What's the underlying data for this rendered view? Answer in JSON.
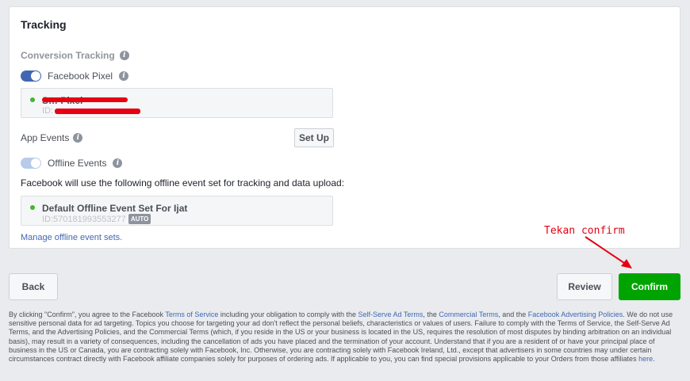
{
  "card": {
    "title": "Tracking",
    "conversion_label": "Conversion Tracking",
    "pixel_toggle_label": "Facebook Pixel",
    "pixel": {
      "name": "S… Pixel",
      "id_prefix": "ID:"
    },
    "app_events_label": "App Events",
    "setup_label": "Set Up",
    "offline_toggle_label": "Offline Events",
    "offline_description": "Facebook will use the following offline event set for tracking and data upload:",
    "offline_set": {
      "name": "Default Offline Event Set For Ijat",
      "id": "ID:570181993553277",
      "badge": "AUTO"
    },
    "manage_link": "Manage offline event sets."
  },
  "actions": {
    "back": "Back",
    "review": "Review",
    "confirm": "Confirm"
  },
  "annotation": {
    "text": "Tekan confirm",
    "color": "#e60012"
  },
  "legal": {
    "p1": "By clicking \"Confirm\", you agree to the Facebook ",
    "l1": "Terms of Service",
    "p2": " including your obligation to comply with the ",
    "l2": "Self-Serve Ad Terms",
    "p3": ", the ",
    "l3": "Commercial Terms",
    "p4": ", and the ",
    "l4": "Facebook Advertising Policies",
    "p5": ". We do not use sensitive personal data for ad targeting. Topics you choose for targeting your ad don't reflect the personal beliefs, characteristics or values of users. Failure to comply with the Terms of Service, the Self-Serve Ad Terms, and the Advertising Policies, and the Commercial Terms (which, if you reside in the US or your business is located in the US, requires the resolution of most disputes by binding arbitration on an individual basis), may result in a variety of consequences, including the cancellation of ads you have placed and the termination of your account. Understand that if you are a resident of or have your principal place of business in the US or Canada, you are contracting solely with Facebook, Inc. Otherwise, you are contracting solely with Facebook Ireland, Ltd., except that advertisers in some countries may under certain circumstances contract directly with Facebook affiliate companies solely for purposes of ordering ads. If applicable to you, you can find special provisions applicable to your Orders from those affiliates ",
    "l5": "here",
    "p6": "."
  },
  "colors": {
    "accent": "#4267b2",
    "confirm": "#00a400",
    "status_active": "#42b72a"
  }
}
